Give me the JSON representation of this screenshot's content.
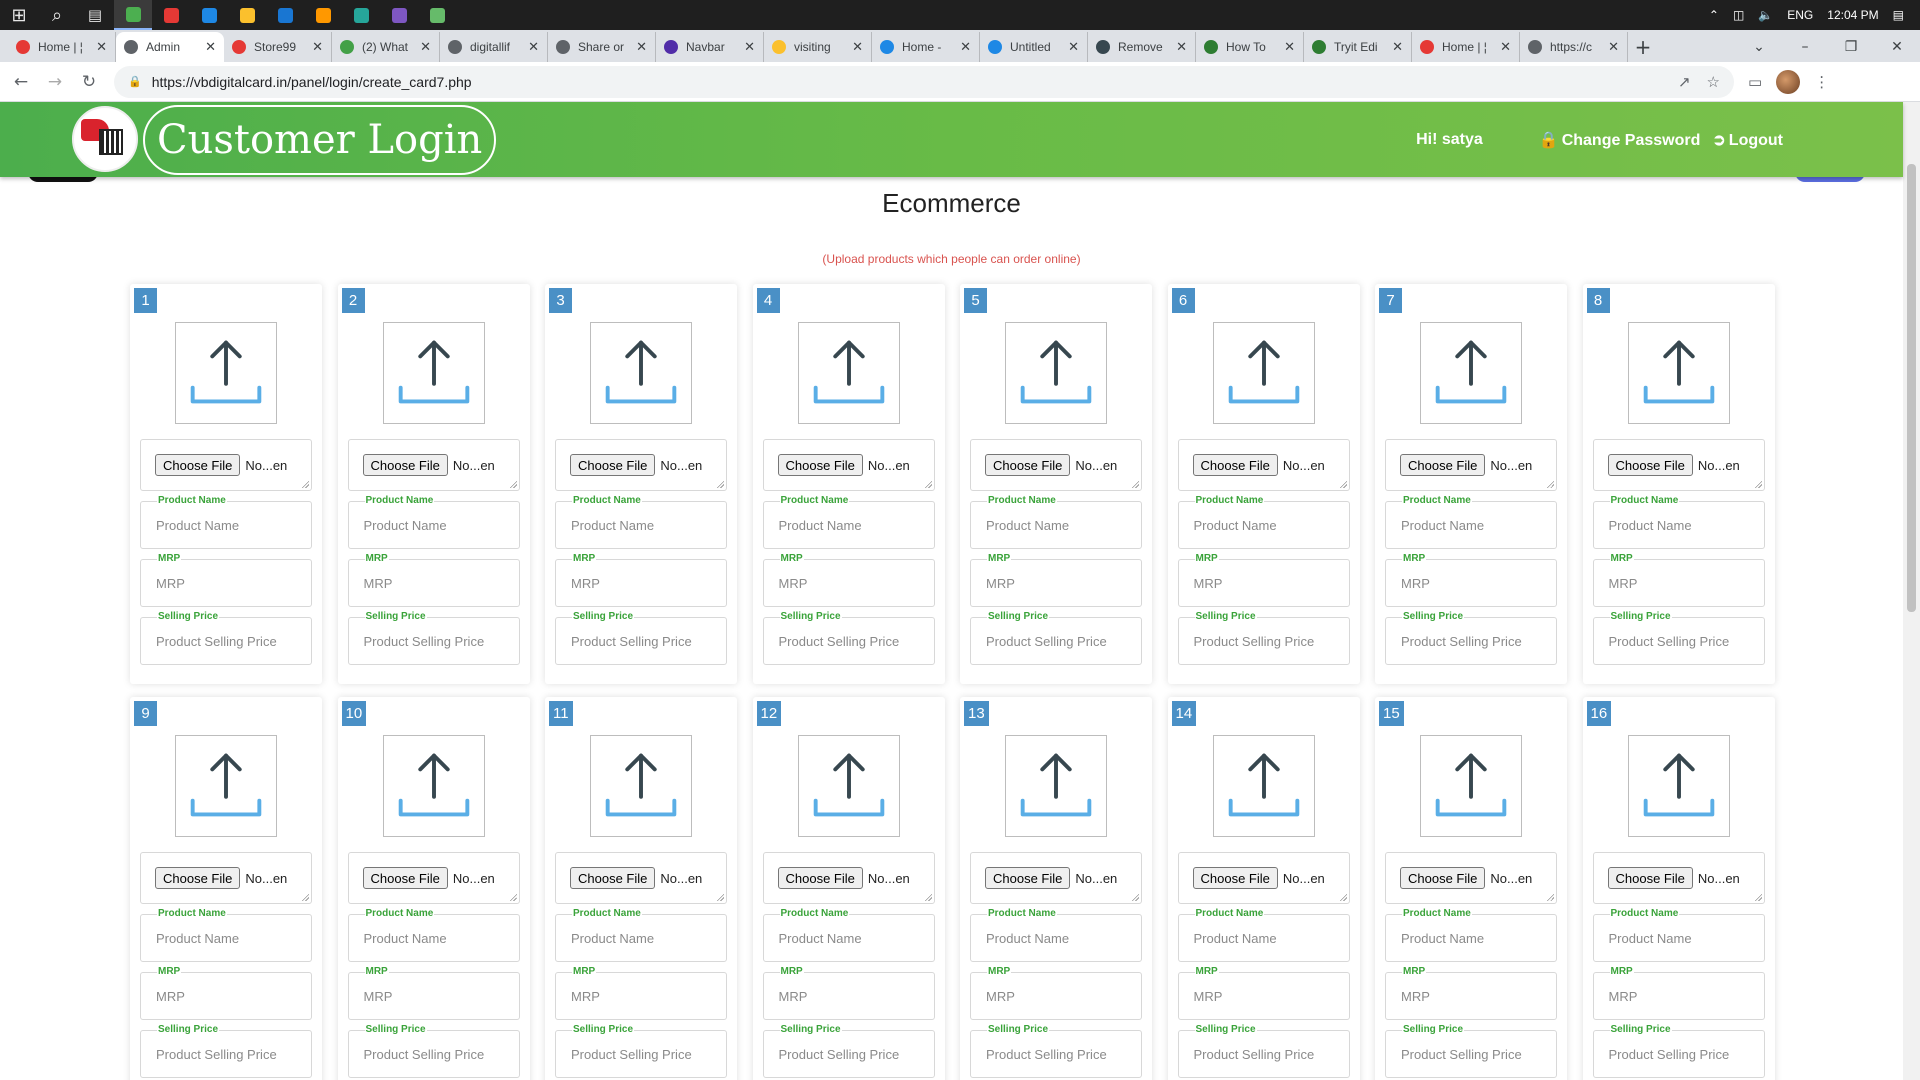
{
  "taskbar": {
    "apps": [
      {
        "name": "windows-start",
        "color": "#ffffff"
      },
      {
        "name": "search",
        "color": "#ffffff"
      },
      {
        "name": "task-view",
        "color": "#ffffff"
      },
      {
        "name": "chrome",
        "color": "#4caf50"
      },
      {
        "name": "anydesk",
        "color": "#e53935"
      },
      {
        "name": "skype",
        "color": "#1e88e5"
      },
      {
        "name": "file-explorer",
        "color": "#fbc02d"
      },
      {
        "name": "mail",
        "color": "#1976d2"
      },
      {
        "name": "sublime",
        "color": "#ff9800"
      },
      {
        "name": "gallery",
        "color": "#26a69a"
      },
      {
        "name": "obs",
        "color": "#7e57c2"
      },
      {
        "name": "green-app",
        "color": "#66bb6a"
      }
    ],
    "lang": "ENG",
    "time": "12:04 PM"
  },
  "tabs": [
    {
      "title": "Home | ¦",
      "fav": "#e53935"
    },
    {
      "title": "Admin",
      "fav": "#5f6368",
      "active": true
    },
    {
      "title": "Store99",
      "fav": "#e53935"
    },
    {
      "title": "(2) What",
      "fav": "#43a047"
    },
    {
      "title": "digitallif",
      "fav": "#5f6368"
    },
    {
      "title": "Share or",
      "fav": "#5f6368"
    },
    {
      "title": "Navbar",
      "fav": "#512da8"
    },
    {
      "title": "visiting",
      "fav": "#fbc02d"
    },
    {
      "title": "Home -",
      "fav": "#1e88e5"
    },
    {
      "title": "Untitled",
      "fav": "#1e88e5"
    },
    {
      "title": "Remove",
      "fav": "#37474f"
    },
    {
      "title": "How To",
      "fav": "#2e7d32"
    },
    {
      "title": "Tryit Edi",
      "fav": "#2e7d32"
    },
    {
      "title": "Home | ¦",
      "fav": "#e53935"
    },
    {
      "title": "https://c",
      "fav": "#5f6368"
    }
  ],
  "address": {
    "url": "https://vbdigitalcard.in/panel/login/create_card7.php"
  },
  "header": {
    "brand": "Customer Login",
    "greeting": "Hi! satya",
    "change_password": "Change Password",
    "logout": "Logout",
    "color_start": "#4cae4c",
    "color_end": "#7bc04a"
  },
  "page": {
    "title": "Ecommerce",
    "subtitle": "(Upload products which people can order online)"
  },
  "product_form": {
    "choose_file": "Choose File",
    "no_file": "No...en",
    "name_label": "Product Name",
    "name_placeholder": "Product Name",
    "mrp_label": "MRP",
    "mrp_placeholder": "MRP",
    "price_label": "Selling Price",
    "price_placeholder": "Product Selling Price"
  },
  "products": [
    {
      "num": "1"
    },
    {
      "num": "2"
    },
    {
      "num": "3"
    },
    {
      "num": "4"
    },
    {
      "num": "5"
    },
    {
      "num": "6"
    },
    {
      "num": "7"
    },
    {
      "num": "8"
    },
    {
      "num": "9"
    },
    {
      "num": "10"
    },
    {
      "num": "11"
    },
    {
      "num": "12"
    },
    {
      "num": "13"
    },
    {
      "num": "14"
    },
    {
      "num": "15"
    },
    {
      "num": "16"
    }
  ],
  "colors": {
    "badge": "#4a90c6",
    "label_green": "#3aa33a",
    "subtitle_red": "#d9534f",
    "upload_arrow": "#37474f",
    "upload_tray": "#5aaee6"
  }
}
